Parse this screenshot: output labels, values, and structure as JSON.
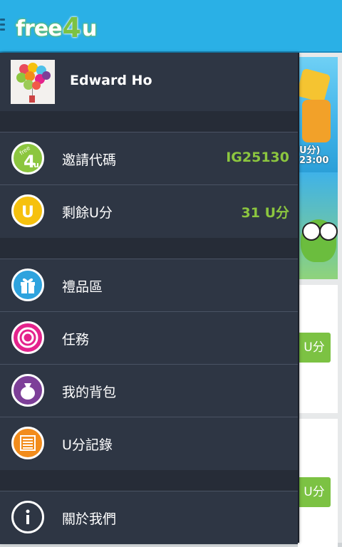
{
  "app": {
    "logo": {
      "free": "free",
      "four": "4",
      "u": "u"
    }
  },
  "profile": {
    "name": "Edward Ho"
  },
  "menu_top": [
    {
      "label": "邀請代碼",
      "value": "IG25130",
      "icon": "free4u-logo-icon",
      "color": "#8cc63f"
    },
    {
      "label": "剩餘U分",
      "value": "31 U分",
      "icon": "u-points-icon",
      "color": "#f6c10e"
    }
  ],
  "menu_main": [
    {
      "label": "禮品區",
      "icon": "gift-icon",
      "color": "#2ea3de"
    },
    {
      "label": "任務",
      "icon": "target-icon",
      "color": "#e4238c"
    },
    {
      "label": "我的背包",
      "icon": "bag-icon",
      "color": "#7d3f98"
    },
    {
      "label": "U分記錄",
      "icon": "record-list-icon",
      "color": "#f28c1c"
    }
  ],
  "menu_bottom": [
    {
      "label": "關於我們",
      "icon": "info-icon",
      "color": "#2e3644"
    }
  ],
  "background": {
    "banner_text_1": "U分)",
    "banner_text_2": "23:00",
    "button_label": "U分"
  }
}
